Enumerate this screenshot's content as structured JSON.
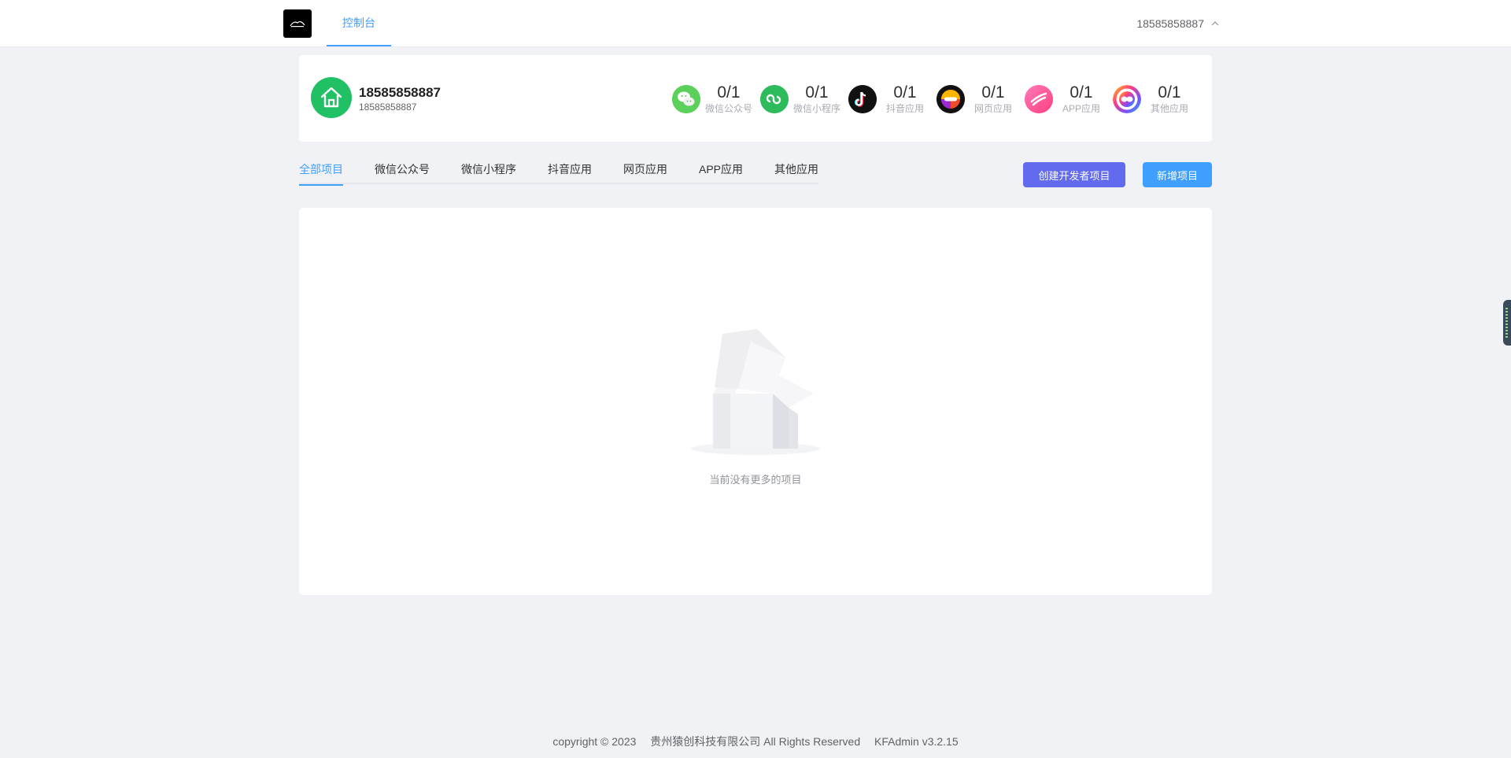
{
  "header": {
    "nav_tab": "控制台",
    "username": "18585858887"
  },
  "profile": {
    "name": "18585858887",
    "sub": "18585858887"
  },
  "stats": [
    {
      "count": "0/1",
      "label": "微信公众号",
      "icon": "wechat-icon"
    },
    {
      "count": "0/1",
      "label": "微信小程序",
      "icon": "mini-program-icon"
    },
    {
      "count": "0/1",
      "label": "抖音应用",
      "icon": "douyin-icon"
    },
    {
      "count": "0/1",
      "label": "网页应用",
      "icon": "web-app-icon"
    },
    {
      "count": "0/1",
      "label": "APP应用",
      "icon": "app-icon"
    },
    {
      "count": "0/1",
      "label": "其他应用",
      "icon": "other-app-icon"
    }
  ],
  "tabs": [
    "全部项目",
    "微信公众号",
    "微信小程序",
    "抖音应用",
    "网页应用",
    "APP应用",
    "其他应用"
  ],
  "active_tab": 0,
  "buttons": {
    "create_dev": "创建开发者项目",
    "new_project": "新增项目"
  },
  "empty": {
    "text": "当前没有更多的项目"
  },
  "footer": {
    "copyright": "copyright © 2023",
    "company": "贵州猿创科技有限公司 All Rights Reserved",
    "version": "KFAdmin v3.2.15"
  },
  "colors": {
    "accent": "#409eff",
    "dev_button": "#626aef",
    "avatar": "#21c064",
    "background": "#f0f2f5"
  }
}
